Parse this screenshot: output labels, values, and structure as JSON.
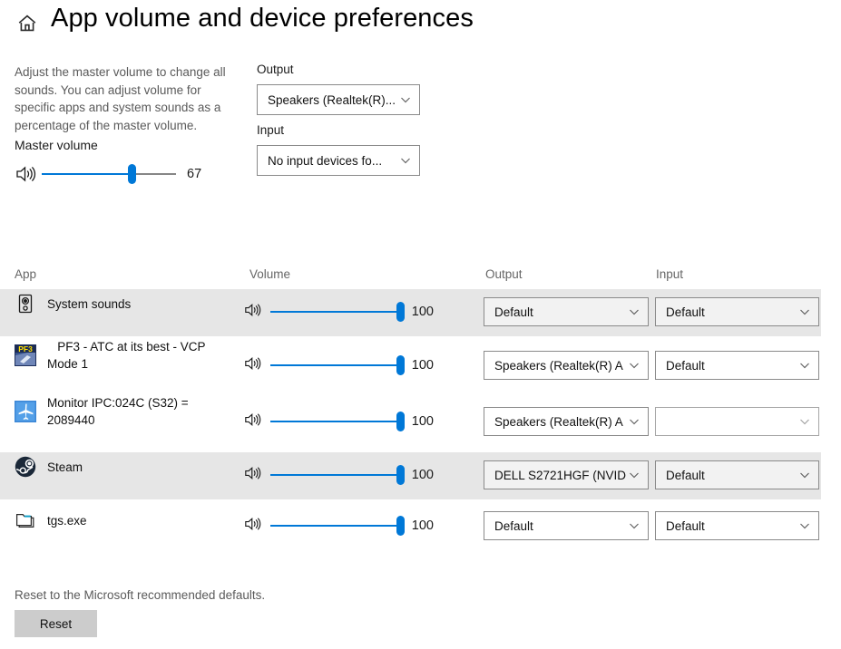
{
  "header": {
    "home_icon": "home-icon",
    "title": "App volume and device preferences"
  },
  "intro": {
    "description": "Adjust the master volume to change all sounds. You can adjust volume for specific apps and system sounds as a percentage of the master volume.",
    "master_volume_label": "Master volume",
    "master_volume_value": "67",
    "master_volume_percent": 67,
    "speaker_icon": "speaker-icon"
  },
  "device": {
    "output_label": "Output",
    "output_value": "Speakers (Realtek(R)...",
    "input_label": "Input",
    "input_value": "No input devices fo...",
    "chevron_icon": "chevron-down-icon"
  },
  "table": {
    "columns": {
      "app": "App",
      "volume": "Volume",
      "output": "Output",
      "input": "Input"
    },
    "rows": [
      {
        "icon": "system-sounds-icon",
        "name": "System sounds",
        "volume_value": "100",
        "volume_percent": 100,
        "output": "Default",
        "input": "Default",
        "shaded": true
      },
      {
        "icon": "pf3-app-icon",
        "name": "   PF3 - ATC at its best - VCP Mode 1",
        "volume_value": "100",
        "volume_percent": 100,
        "output": "Speakers (Realtek(R) A",
        "input": "Default",
        "shaded": false
      },
      {
        "icon": "airplane-icon",
        "name": "Monitor IPC:024C (S32) = 2089440",
        "volume_value": "100",
        "volume_percent": 100,
        "output": "Speakers (Realtek(R) A",
        "input": "",
        "shaded": false
      },
      {
        "icon": "steam-icon",
        "name": "Steam",
        "volume_value": "100",
        "volume_percent": 100,
        "output": "DELL S2721HGF (NVID",
        "input": "Default",
        "shaded": true
      },
      {
        "icon": "folder-icon",
        "name": "tgs.exe",
        "volume_value": "100",
        "volume_percent": 100,
        "output": "Default",
        "input": "Default",
        "shaded": false
      }
    ]
  },
  "footer": {
    "reset_note": "Reset to the Microsoft recommended defaults.",
    "reset_label": "Reset"
  },
  "colors": {
    "accent": "#0078d7",
    "row_shade": "#e6e6e6",
    "muted_text": "#5a5a5a",
    "border": "#8a8a8a"
  }
}
